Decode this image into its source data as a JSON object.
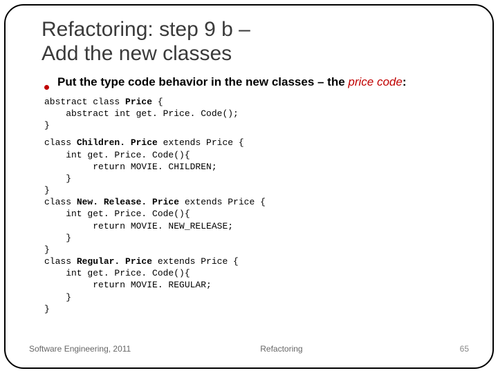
{
  "title_line1": "Refactoring: step 9 b –",
  "title_line2": "Add the new classes",
  "bullet_prefix": "Put the type code behavior in the new classes – the ",
  "bullet_italic": "price code",
  "bullet_suffix": ":",
  "code1": {
    "l1a": "abstract class ",
    "l1b": "Price",
    "l1c": " {",
    "l2": "    abstract int get. Price. Code();",
    "l3": "}"
  },
  "code2": {
    "l1a": "class ",
    "l1b": "Children. Price",
    "l1c": " extends Price {",
    "l2": "    int get. Price. Code(){",
    "l3": "         return MOVIE. CHILDREN;",
    "l4": "    }",
    "l5": "}",
    "l6a": "class ",
    "l6b": "New. Release. Price",
    "l6c": " extends Price {",
    "l7": "    int get. Price. Code(){",
    "l8": "         return MOVIE. NEW_RELEASE;",
    "l9": "    }",
    "l10": "}",
    "l11a": "class ",
    "l11b": "Regular. Price",
    "l11c": " extends Price {",
    "l12": "    int get. Price. Code(){",
    "l13": "         return MOVIE. REGULAR;",
    "l14": "    }",
    "l15": "}"
  },
  "footer": {
    "left": "Software Engineering, 2011",
    "center": "Refactoring",
    "right": "65"
  }
}
